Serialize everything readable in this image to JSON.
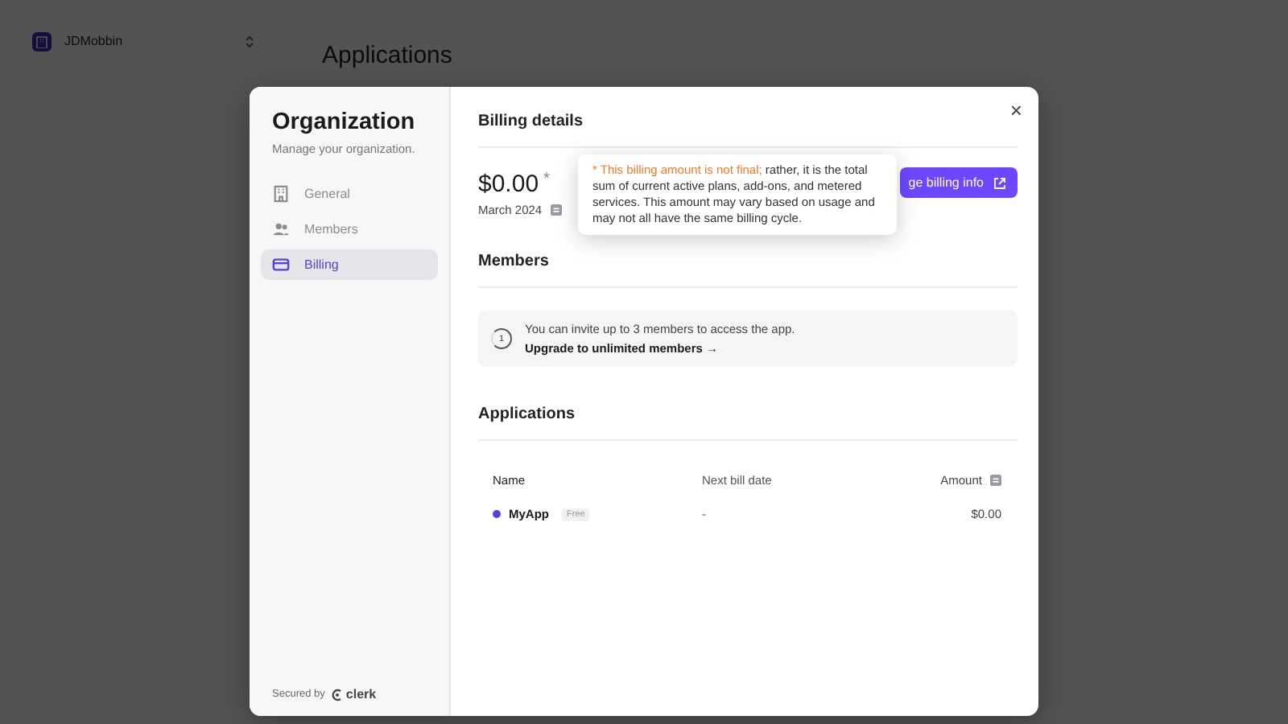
{
  "background": {
    "org_switcher": {
      "name": "JDMobbin"
    },
    "heading": "Applications"
  },
  "sidebar": {
    "title": "Organization",
    "subtitle": "Manage your organization.",
    "items": [
      {
        "label": "General",
        "kind": "general",
        "selected": false
      },
      {
        "label": "Members",
        "kind": "members",
        "selected": false
      },
      {
        "label": "Billing",
        "kind": "billing",
        "selected": true
      }
    ],
    "footer": {
      "prefix": "Secured by",
      "brand": "clerk"
    }
  },
  "billing": {
    "title": "Billing details",
    "amount": "$0.00",
    "asterisk": "*",
    "period": "March 2024",
    "button": "ge billing info",
    "tooltip": {
      "highlight": "* This billing amount is not final;",
      "text": " rather, it is the total sum of current active plans, add-ons, and metered services. This amount may vary based on usage and may not all have the same billing cycle."
    }
  },
  "members": {
    "title": "Members",
    "count": "1",
    "message": "You can invite up to 3 members to access the app.",
    "link": "Upgrade to unlimited members →"
  },
  "applications": {
    "title": "Applications",
    "table": {
      "columns": [
        "Name",
        "Next bill date",
        "Amount"
      ],
      "rows": [
        {
          "name": "MyApp",
          "color": "#5b3fd9",
          "badge": "Free",
          "next_bill_date": "-",
          "amount": "$0.00"
        }
      ]
    }
  },
  "close_label": "×"
}
